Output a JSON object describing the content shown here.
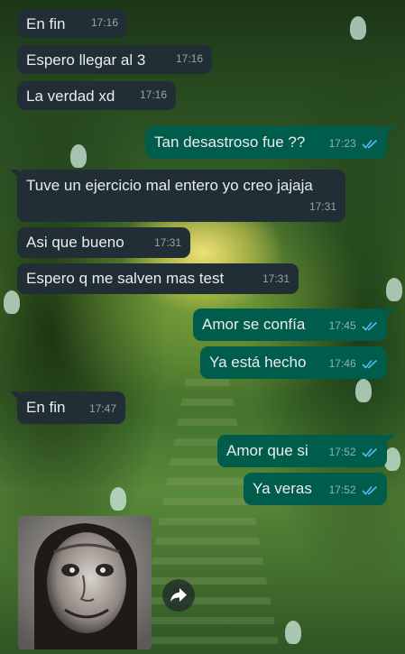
{
  "colors": {
    "incoming_bubble": "#222e35",
    "outgoing_bubble": "#005c4b",
    "read_tick": "#53bdeb",
    "text": "#e9edef"
  },
  "messages": [
    {
      "direction": "in",
      "text": "En fin",
      "time": "17:16"
    },
    {
      "direction": "in",
      "text": "Espero llegar al 3",
      "time": "17:16"
    },
    {
      "direction": "in",
      "text": "La verdad xd",
      "time": "17:16"
    },
    {
      "direction": "out",
      "text": "Tan desastroso fue ??",
      "time": "17:23",
      "status": "read"
    },
    {
      "direction": "in",
      "text": "Tuve un ejercicio mal entero yo creo jajaja",
      "time": "17:31"
    },
    {
      "direction": "in",
      "text": "Asi que bueno",
      "time": "17:31"
    },
    {
      "direction": "in",
      "text": "Espero q me salven mas test",
      "time": "17:31"
    },
    {
      "direction": "out",
      "text": "Amor se confía",
      "time": "17:45",
      "status": "read"
    },
    {
      "direction": "out",
      "text": "Ya está hecho",
      "time": "17:46",
      "status": "read"
    },
    {
      "direction": "in",
      "text": "En fin",
      "time": "17:47"
    },
    {
      "direction": "out",
      "text": "Amor que si",
      "time": "17:52",
      "status": "read"
    },
    {
      "direction": "out",
      "text": "Ya veras",
      "time": "17:52",
      "status": "read"
    }
  ],
  "media": {
    "type": "image",
    "direction": "in"
  },
  "icons": {
    "forward": "forward-icon",
    "read": "double-check-icon"
  }
}
